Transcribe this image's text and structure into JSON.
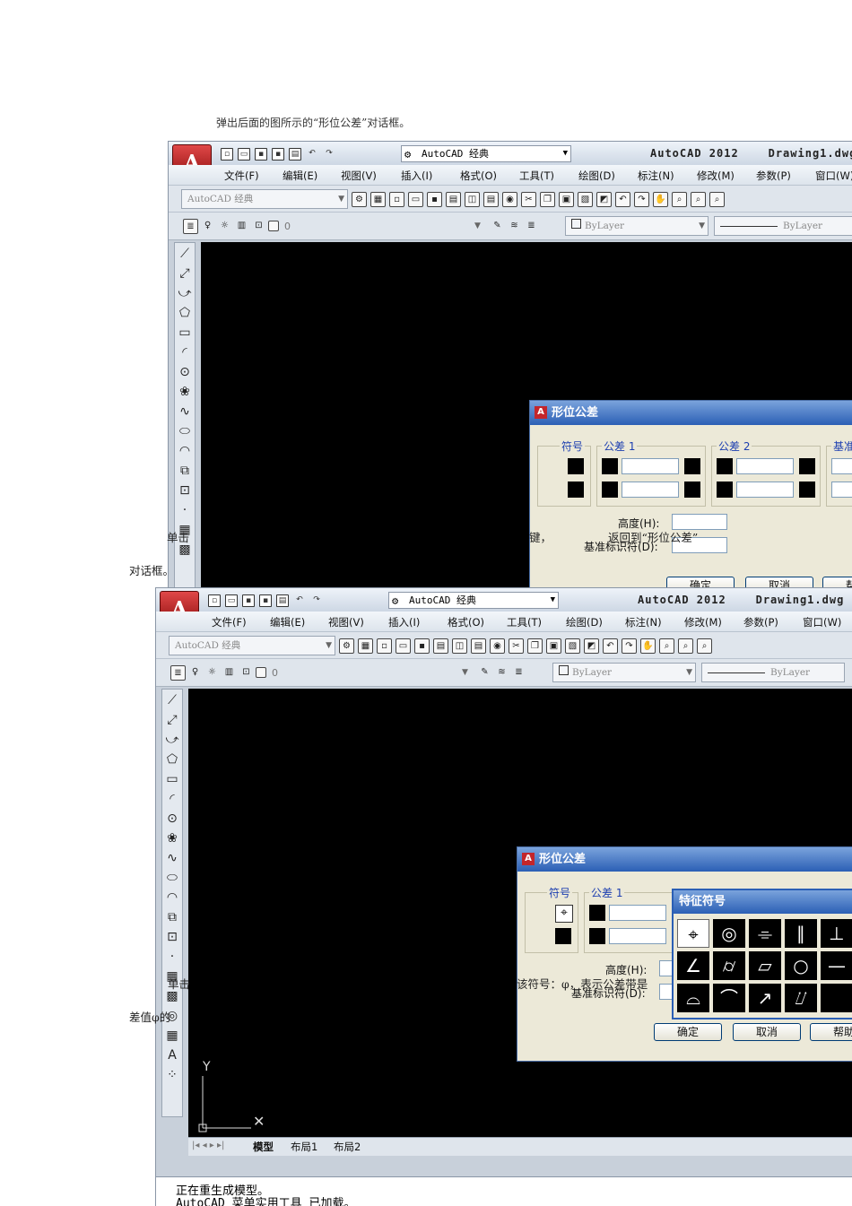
{
  "doc": {
    "intro": "弹出后面的图所示的“形位公差”对话框。",
    "overlay1_a": "单击",
    "overlay1_b": "键，",
    "overlay1_c": "返回到“形位公差”",
    "overlay1_d": "对话框。",
    "overlay2_a": "单击",
    "overlay2_b": "该符号：φ，表示公差带是",
    "overlay2_c": "差值φ的"
  },
  "app": {
    "workspace": "AutoCAD 经典",
    "title": "AutoCAD 2012",
    "drawing": "Drawing1.dwg",
    "menus": [
      "文件(F)",
      "编辑(E)",
      "视图(V)",
      "插入(I)",
      "格式(O)",
      "工具(T)",
      "绘图(D)",
      "标注(N)",
      "修改(M)",
      "参数(P)",
      "窗口(W)"
    ],
    "ws_combo": "AutoCAD 经典",
    "layer": "0",
    "color": "ByLayer",
    "linetype": "ByLayer",
    "tabs": [
      "模型",
      "布局1",
      "布局2"
    ],
    "cmd_lines": [
      "正在重生成模型。",
      "AutoCAD 菜单实用工具 已加载。"
    ]
  },
  "gdt_dialog": {
    "title": "形位公差",
    "symbol_label": "符号",
    "tol1_label": "公差 1",
    "tol2_label": "公差 2",
    "datum_label": "基准",
    "height_label": "高度(H):",
    "datum_id_label": "基准标识符(D):",
    "ok": "确定",
    "cancel": "取消",
    "help": "帮助"
  },
  "symbol_popup": {
    "title": "特征符号",
    "symbols": [
      "⌖",
      "◎",
      "⌯",
      "∥",
      "⊥",
      "∠",
      "⌭",
      "▱",
      "○",
      "—",
      "⌓",
      "⌒",
      "↗",
      "⌰",
      ""
    ]
  },
  "icons": {
    "app": "autocad-logo-icon",
    "ucs": "ucs-axis-icon"
  }
}
